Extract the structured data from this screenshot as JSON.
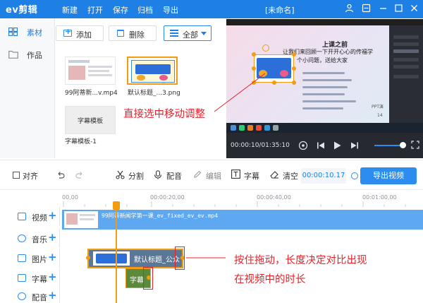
{
  "app": {
    "logo": "ev剪辑",
    "menu": [
      "新建",
      "打开",
      "保存",
      "归档",
      "导出"
    ],
    "document_title": "[未命名]",
    "window_controls": [
      "user-icon",
      "settings-icon",
      "minimize-icon",
      "maximize-icon",
      "close-icon"
    ]
  },
  "left_nav": [
    {
      "label": "素材",
      "icon": "material-icon",
      "active": true
    },
    {
      "label": "作品",
      "icon": "folder-icon",
      "active": false
    }
  ],
  "media_toolbar": {
    "add_label": "添加",
    "delete_label": "删除",
    "filter_value": "全部"
  },
  "media_items": [
    {
      "label": "99阿蒂新...v.mp4",
      "type": "video"
    },
    {
      "label": "默认标题_...3.png",
      "type": "image"
    },
    {
      "label": "字幕模板-1",
      "type": "subtitle",
      "thumb_text": "字幕模板"
    }
  ],
  "preview": {
    "slide_title": "上课之前",
    "slide_line1": "让我们来回顾一下开开心心的传福学",
    "slide_line2": "个小问题，送给大家",
    "slide_text_right": "PPT演",
    "slide_number": "14",
    "time_display": "00:00:10/01:35:10"
  },
  "annotations": {
    "move_hint": "直接选中移动调整",
    "drag_hint_line1": "按住拖动，长度决定对比出现",
    "drag_hint_line2": "在视频中的时长"
  },
  "edit_toolbar": {
    "align_label": "对齐",
    "split_label": "分割",
    "dub_label": "配音",
    "edit_label": "编辑",
    "subtitle_label": "字幕",
    "clear_label": "清空",
    "timecode": "00:00:10.17",
    "export_label": "导出视频"
  },
  "timeline": {
    "ticks": [
      "00,00",
      "00:00:20,00",
      "00:00:40,00",
      "00:01:00,00"
    ],
    "tracks": [
      {
        "label": "视频",
        "icon": "video-icon"
      },
      {
        "label": "音乐",
        "icon": "music-icon"
      },
      {
        "label": "图片",
        "icon": "image-icon"
      },
      {
        "label": "字幕",
        "icon": "text-icon"
      },
      {
        "label": "配音",
        "icon": "mic-icon"
      }
    ],
    "video_clip_label": "99阿蒂新闻学第一课_ev_fixed_ev_ev.mp4",
    "image_clip_label": "默认标题_公众",
    "subtitle_clip_label": "字幕"
  },
  "colors": {
    "brand_blue": "#1e7fe4",
    "accent_orange": "#f39c12",
    "annotation_red": "#e8222b"
  }
}
